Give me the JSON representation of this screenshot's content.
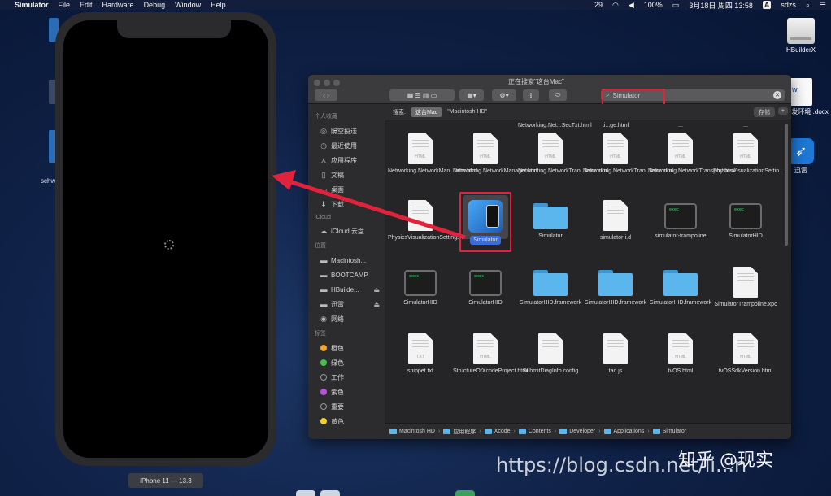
{
  "menubar": {
    "app": "Simulator",
    "items": [
      "File",
      "Edit",
      "Hardware",
      "Debug",
      "Window",
      "Help"
    ],
    "status": {
      "ime_badge": "29",
      "battery": "100%",
      "date_time": "3月18日 周四 13:58",
      "ime": "A",
      "user": "sdzs"
    }
  },
  "desktop": {
    "left_label": "schw",
    "icons": [
      {
        "label": "HBuilderX"
      },
      {
        "label": "App开发环境 .docx",
        "tag": "W"
      },
      {
        "label": "迅雷"
      }
    ]
  },
  "simulator": {
    "device_label": "iPhone 11 — 13.3"
  },
  "finder": {
    "window_title": "正在搜索\"这台Mac\"",
    "search_query": "Simulator",
    "scope": {
      "prefix": "搜索:",
      "active": "这台Mac",
      "other": "\"Macintosh HD\"",
      "save": "存储",
      "add": "+"
    },
    "sidebar": {
      "favorites_header": "个人收藏",
      "favorites": [
        {
          "label": "隔空投送",
          "icon": "airdrop-icon"
        },
        {
          "label": "最近使用",
          "icon": "clock-icon"
        },
        {
          "label": "应用程序",
          "icon": "applications-icon"
        },
        {
          "label": "文稿",
          "icon": "document-icon"
        },
        {
          "label": "桌面",
          "icon": "desktop-icon"
        },
        {
          "label": "下载",
          "icon": "download-icon"
        }
      ],
      "icloud_header": "iCloud",
      "icloud": [
        {
          "label": "iCloud 云盘",
          "icon": "cloud-icon"
        }
      ],
      "locations_header": "位置",
      "locations": [
        {
          "label": "Macintosh...",
          "icon": "disk-icon"
        },
        {
          "label": "BOOTCAMP",
          "icon": "disk-icon"
        },
        {
          "label": "HBuilde...",
          "icon": "disk-icon"
        },
        {
          "label": "迅雷",
          "icon": "disk-icon"
        },
        {
          "label": "网络",
          "icon": "network-icon"
        }
      ],
      "tags_header": "标签",
      "tags": [
        {
          "label": "橙色",
          "color": "#f5a623"
        },
        {
          "label": "绿色",
          "color": "#3fc34a"
        },
        {
          "label": "工作",
          "color": ""
        },
        {
          "label": "紫色",
          "color": "#b652d6"
        },
        {
          "label": "重要",
          "color": ""
        },
        {
          "label": "黄色",
          "color": "#f2d02b"
        }
      ]
    },
    "partial_row": [
      "Networking.Net...SecTxt.html",
      "ti...ge.html",
      "...",
      "..."
    ],
    "items": [
      {
        "label": "Networking.NetworkMan...lator.html",
        "kind": "doc",
        "ext": "HTML"
      },
      {
        "label": "Networking.NetworkManager.html",
        "kind": "doc",
        "ext": "HTML"
      },
      {
        "label": "Networking.NetworkTran...lator.html",
        "kind": "doc",
        "ext": "HTML"
      },
      {
        "label": "Networking.NetworkTran...lator.html",
        "kind": "doc",
        "ext": "HTML"
      },
      {
        "label": "Networking.NetworkTransport.html",
        "kind": "doc",
        "ext": "HTML"
      },
      {
        "label": "PhysicsVisualizationSettin...ior.html",
        "kind": "doc",
        "ext": "HTML"
      },
      {
        "label": "PhysicsVisualizationSettings.html",
        "kind": "doc",
        "ext": "HTML"
      },
      {
        "label": "Simulator",
        "kind": "app",
        "ext": ""
      },
      {
        "label": "Simulator",
        "kind": "folder",
        "ext": ""
      },
      {
        "label": "simulator-i.d",
        "kind": "doc",
        "ext": ""
      },
      {
        "label": "simulator-trampoline",
        "kind": "term",
        "ext": "exec"
      },
      {
        "label": "SimulatorHID",
        "kind": "term",
        "ext": "exec"
      },
      {
        "label": "SimulatorHID",
        "kind": "term",
        "ext": "exec"
      },
      {
        "label": "SimulatorHID",
        "kind": "term",
        "ext": "exec"
      },
      {
        "label": "SimulatorHID.framework",
        "kind": "folder",
        "ext": ""
      },
      {
        "label": "SimulatorHID.framework",
        "kind": "folder",
        "ext": ""
      },
      {
        "label": "SimulatorHID.framework",
        "kind": "folder",
        "ext": ""
      },
      {
        "label": "SimulatorTrampoline.xpc",
        "kind": "doc",
        "ext": ""
      },
      {
        "label": "snippet.txt",
        "kind": "doc",
        "ext": "TXT"
      },
      {
        "label": "StructureOfXcodeProject.html",
        "kind": "doc",
        "ext": "HTML"
      },
      {
        "label": "SubmitDiagInfo.config",
        "kind": "doc",
        "ext": ""
      },
      {
        "label": "tao.js",
        "kind": "doc",
        "ext": ""
      },
      {
        "label": "tvOS.html",
        "kind": "doc",
        "ext": "HTML"
      },
      {
        "label": "tvOSSdkVersion.html",
        "kind": "doc",
        "ext": "HTML"
      }
    ],
    "pathbar": [
      "Macintosh HD",
      "应用程序",
      "Xcode",
      "Contents",
      "Developer",
      "Applications",
      "Simulator"
    ]
  },
  "watermark": {
    "url": "https://blog.csdn.net/li...n",
    "cn": "知乎 @现实"
  }
}
